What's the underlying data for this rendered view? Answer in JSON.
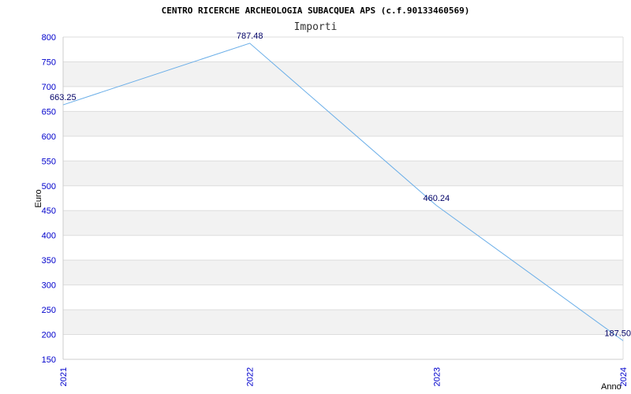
{
  "chart_data": {
    "type": "line",
    "title": "CENTRO RICERCHE ARCHEOLOGIA SUBACQUEA APS (c.f.90133460569)",
    "subtitle": "Importi",
    "xlabel": "Anno",
    "ylabel": "Euro",
    "x": [
      "2021",
      "2022",
      "2023",
      "2024"
    ],
    "series": [
      {
        "values": [
          663.25,
          787.48,
          460.24,
          187.5
        ]
      }
    ],
    "data_labels": [
      "663.25",
      "787.48",
      "460.24",
      "187.50"
    ],
    "ylim": [
      150,
      800
    ],
    "yticks": [
      150,
      200,
      250,
      300,
      350,
      400,
      450,
      500,
      550,
      600,
      650,
      700,
      750,
      800
    ],
    "grid": true,
    "colors": {
      "line": "#6aaee8",
      "tick_label": "#0000cc",
      "data_label": "#000066",
      "band": "#f2f2f2",
      "grid": "#dddddd"
    }
  }
}
